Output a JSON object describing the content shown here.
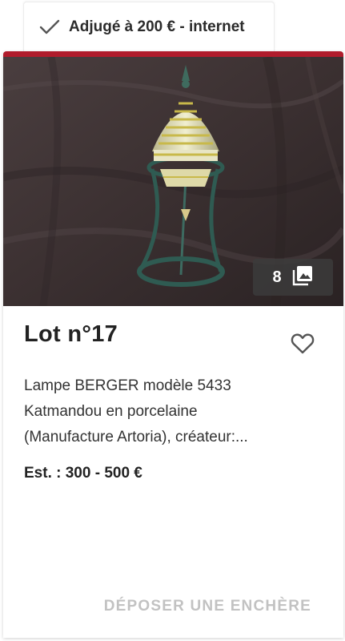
{
  "sold_badge": {
    "icon": "check-icon",
    "text": "Adjugé à 200 € - internet"
  },
  "lot": {
    "photo_count": "8",
    "photo_icon": "photo-library-icon",
    "title": "Lot n°17",
    "favorite_icon": "heart-outline-icon",
    "description_lines": [
      "Lampe BERGER modèle 5433",
      "Katmandou en porcelaine",
      "(Manufacture Artoria), créateur:..."
    ],
    "estimate": "Est. : 300 - 500 €",
    "bid_button_label": "DÉPOSER UNE ENCHÈRE"
  },
  "colors": {
    "accent": "#b01c2c",
    "disabled_text": "#c2c2c2"
  }
}
